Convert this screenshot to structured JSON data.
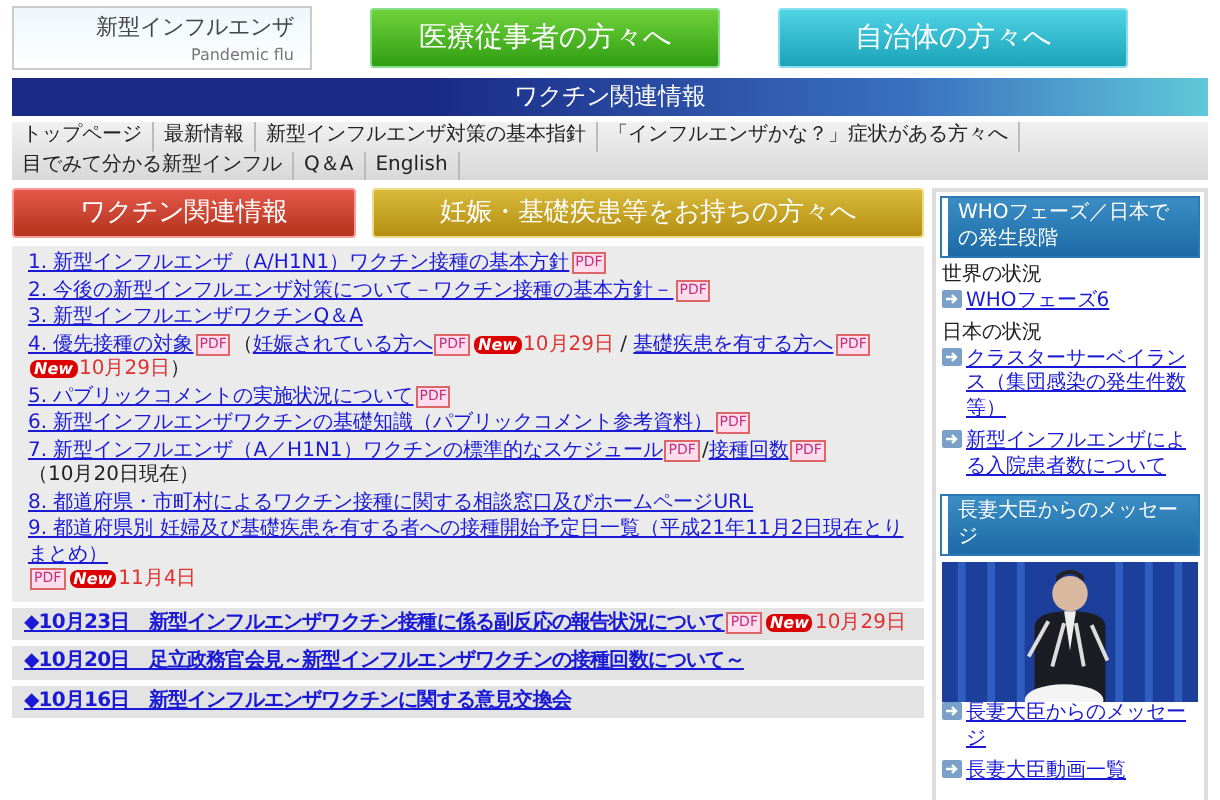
{
  "logo": {
    "title": "新型インフルエンザ",
    "subtitle": "Pandemic flu"
  },
  "audience_buttons": [
    {
      "label": "医療従事者の方々へ",
      "kind": "green"
    },
    {
      "label": "自治体の方々へ",
      "kind": "teal"
    }
  ],
  "page_title": "ワクチン関連情報",
  "nav": [
    "トップページ",
    "最新情報",
    "新型インフルエンザ対策の基本指針",
    "「インフルエンザかな？」症状がある方々へ",
    "目でみて分かる新型インフル",
    "Q＆A",
    "English"
  ],
  "section_buttons": [
    {
      "label": "ワクチン関連情報",
      "kind": "red"
    },
    {
      "label": "妊娠・基礎疾患等をお持ちの方々へ",
      "kind": "gold"
    }
  ],
  "documents": [
    [
      {
        "kind": "link",
        "text": "1. 新型インフルエンザ（A/H1N1）ワクチン接種の基本方針"
      },
      {
        "kind": "pdf",
        "text": "PDF"
      }
    ],
    [
      {
        "kind": "link",
        "text": "2. 今後の新型インフルエンザ対策について－ワクチン接種の基本方針－"
      },
      {
        "kind": "pdf",
        "text": "PDF"
      }
    ],
    [
      {
        "kind": "link",
        "text": "3. 新型インフルエンザワクチンQ＆A"
      }
    ],
    [
      {
        "kind": "link",
        "text": "4. 優先接種の対象"
      },
      {
        "kind": "pdf",
        "text": "PDF"
      },
      {
        "kind": "plain",
        "text": "（"
      },
      {
        "kind": "link",
        "text": "妊娠されている方へ"
      },
      {
        "kind": "pdf",
        "text": "PDF"
      },
      {
        "kind": "new",
        "text": "New"
      },
      {
        "kind": "date",
        "text": "10月29日"
      },
      {
        "kind": "plain",
        "text": " / "
      },
      {
        "kind": "link",
        "text": "基礎疾患を有する方へ"
      },
      {
        "kind": "pdf",
        "text": "PDF"
      },
      {
        "kind": "new",
        "text": "New"
      },
      {
        "kind": "date",
        "text": "10月29日"
      },
      {
        "kind": "plain",
        "text": "）"
      }
    ],
    [
      {
        "kind": "link",
        "text": "5. パブリックコメントの実施状況について"
      },
      {
        "kind": "pdf",
        "text": "PDF"
      }
    ],
    [
      {
        "kind": "link",
        "text": "6. 新型インフルエンザワクチンの基礎知識（パブリックコメント参考資料）"
      },
      {
        "kind": "pdf",
        "text": "PDF"
      }
    ],
    [
      {
        "kind": "link",
        "text": "7. 新型インフルエンザ（A／H1N1）ワクチンの標準的なスケジュール"
      },
      {
        "kind": "pdf",
        "text": "PDF"
      },
      {
        "kind": "plain",
        "text": "/"
      },
      {
        "kind": "link",
        "text": "接種回数"
      },
      {
        "kind": "pdf",
        "text": "PDF"
      },
      {
        "kind": "plain",
        "text": "（10月20日現在）"
      }
    ],
    [
      {
        "kind": "link",
        "text": "8. 都道府県・市町村によるワクチン接種に関する相談窓口及びホームページURL"
      }
    ],
    [
      {
        "kind": "link",
        "text": "9. 都道府県別 妊婦及び基礎疾患を有する者への接種開始予定日一覧（平成21年11月2日現在とりまとめ）"
      },
      {
        "kind": "pdf",
        "text": "PDF"
      },
      {
        "kind": "new",
        "text": "New"
      },
      {
        "kind": "date",
        "text": "11月4日"
      }
    ]
  ],
  "news": [
    [
      {
        "kind": "link",
        "text": "◆10月23日　新型インフルエンザワクチン接種に係る副反応の報告状況について"
      },
      {
        "kind": "pdf",
        "text": "PDF"
      },
      {
        "kind": "new",
        "text": "New"
      },
      {
        "kind": "date",
        "text": "10月29日"
      }
    ],
    [
      {
        "kind": "link",
        "text": "◆10月20日　足立政務官会見～新型インフルエンザワクチンの接種回数について～"
      }
    ],
    [
      {
        "kind": "link",
        "text": "◆10月16日　新型インフルエンザワクチンに関する意見交換会"
      }
    ]
  ],
  "sidebar": {
    "phase_heading": "WHOフェーズ／日本での発生段階",
    "groups": [
      {
        "label": "世界の状況",
        "links": [
          "WHOフェーズ6"
        ]
      },
      {
        "label": "日本の状況",
        "links": [
          "クラスターサーベイランス（集団感染の発生件数等）",
          "新型インフルエンザによる入院患者数について"
        ]
      }
    ],
    "message_heading": "長妻大臣からのメッセージ",
    "photo": {
      "kind": "picture"
    },
    "message_links": [
      "長妻大臣からのメッセージ",
      "長妻大臣動画一覧"
    ]
  }
}
